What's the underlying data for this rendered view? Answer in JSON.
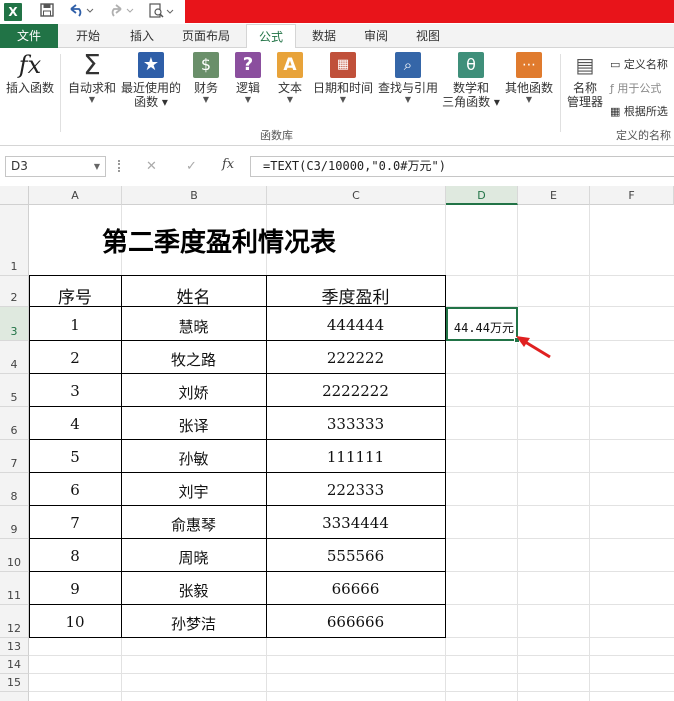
{
  "qat": {
    "excel_logo": "X",
    "save_icon": "save-icon",
    "undo_icon": "undo-icon",
    "redo_icon": "redo-icon",
    "preview_icon": "print-preview-icon"
  },
  "tabs": {
    "file": "文件",
    "home": "开始",
    "insert": "插入",
    "page_layout": "页面布局",
    "formulas": "公式",
    "data": "数据",
    "review": "审阅",
    "view": "视图"
  },
  "ribbon": {
    "insert_function": "插入函数",
    "autosum": "自动求和",
    "recent": "最近使用的",
    "recent_line2": "函数",
    "financial": "财务",
    "logical": "逻辑",
    "text": "文本",
    "datetime": "日期和时间",
    "lookup": "查找与引用",
    "math": "数学和",
    "math_line2": "三角函数",
    "more": "其他函数",
    "name_manager": "名称",
    "name_manager_line2": "管理器",
    "define_name": "定义名称",
    "use_in_formula": "用于公式",
    "create_from_selection": "根据所选",
    "group_library": "函数库",
    "group_defined_names": "定义的名称",
    "colors": {
      "fx": "#222222",
      "sigma": "#333333",
      "star": "#2f5fa8",
      "financial": "#6a8f6a",
      "logical": "#8b4f9e",
      "text": "#e8a33a",
      "datetime": "#c0503a",
      "lookup": "#3566a8",
      "math": "#3f8f7a",
      "more": "#e07b2e"
    }
  },
  "formula_bar": {
    "name_box": "D3",
    "formula": "=TEXT(C3/10000,\"0.0#万元\")",
    "cancel_icon": "✕",
    "enter_icon": "✓",
    "fx_label": "fx"
  },
  "columns": [
    "A",
    "B",
    "C",
    "D",
    "E",
    "F"
  ],
  "rows": [
    "1",
    "2",
    "3",
    "4",
    "5",
    "6",
    "7",
    "8",
    "9",
    "10",
    "11",
    "12",
    "13",
    "14",
    "15"
  ],
  "table": {
    "title": "第二季度盈利情况表",
    "headers": [
      "序号",
      "姓名",
      "季度盈利"
    ],
    "data": [
      [
        "1",
        "慧晓",
        "444444"
      ],
      [
        "2",
        "牧之路",
        "222222"
      ],
      [
        "3",
        "刘娇",
        "2222222"
      ],
      [
        "4",
        "张译",
        "333333"
      ],
      [
        "5",
        "孙敏",
        "111111"
      ],
      [
        "6",
        "刘宇",
        "222333"
      ],
      [
        "7",
        "俞惠琴",
        "3334444"
      ],
      [
        "8",
        "周晓",
        "555566"
      ],
      [
        "9",
        "张毅",
        "66666"
      ],
      [
        "10",
        "孙梦洁",
        "666666"
      ]
    ]
  },
  "d3_value": "44.44万元",
  "accent": "#217346",
  "arrow_color": "#e02020"
}
